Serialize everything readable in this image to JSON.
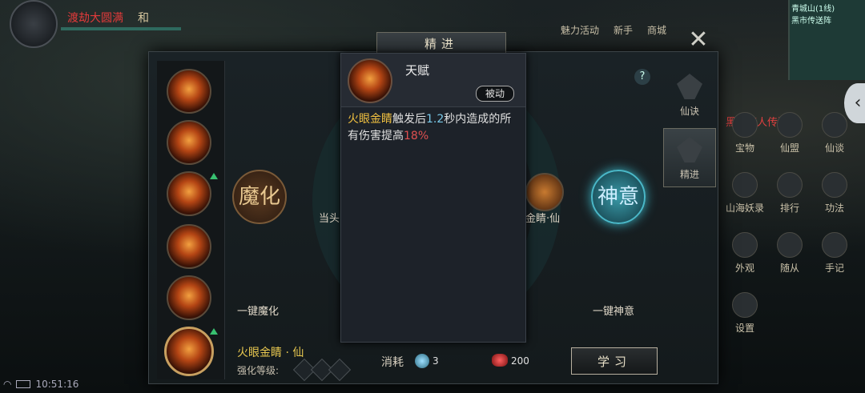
{
  "hud": {
    "player_name": "渡劫大圆满",
    "stat": "和",
    "time": "10:51:16",
    "map_title": "青城山(1线)",
    "map_sub": "黑市传送阵"
  },
  "top_icons": [
    "魅力活动",
    "新手",
    "商城"
  ],
  "panel": {
    "title": "精进",
    "close": "✕",
    "help": "?",
    "left_orb": "魔化",
    "right_orb": "神意",
    "left_node_label": "当头",
    "right_node_label": "金睛·仙",
    "one_key_mo": "一键魔化",
    "one_key_shen": "一键神意",
    "selected_skill": "火眼金睛 · 仙",
    "enhance_label": "强化等级:",
    "cost_label": "消耗",
    "cost_amount_1": "3",
    "cost_amount_2": "200",
    "learn_button": "学习"
  },
  "tabs": [
    {
      "label": "仙诀",
      "active": false
    },
    {
      "label": "精进",
      "active": true
    }
  ],
  "popup": {
    "title": "天赋",
    "badge": "被动",
    "desc_skill": "火眼金睛",
    "desc_part1": "触发后",
    "desc_seconds": "1.2",
    "desc_part2": "秒内造成的所有伤害提高",
    "desc_pct": "18%"
  },
  "right_menu": {
    "merchant": "黑市商人传送阵",
    "items": [
      "宝物",
      "仙盟",
      "仙谈",
      "山海妖录",
      "排行",
      "功法",
      "外观",
      "随从",
      "手记",
      "设置"
    ]
  },
  "colors": {
    "accent_gold": "#f0c040",
    "accent_red": "#e05050",
    "accent_cyan": "#78c8e8",
    "level_up_green": "#38c070"
  }
}
